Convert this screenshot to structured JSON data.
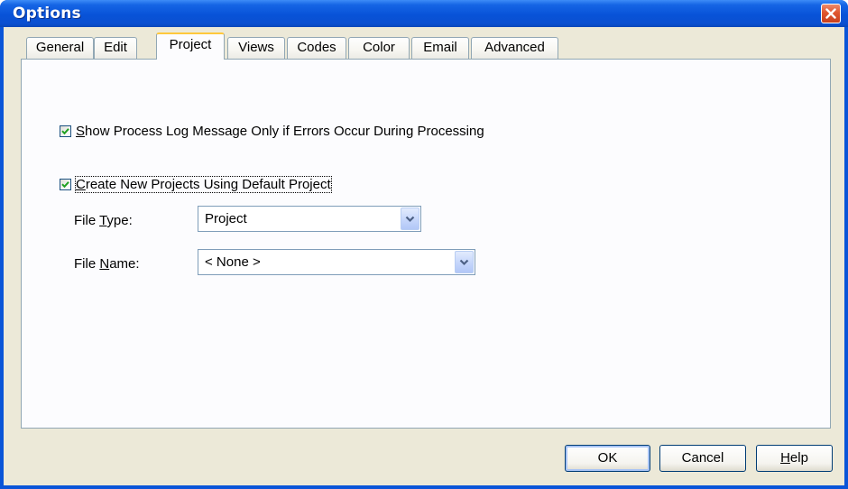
{
  "window": {
    "title": "Options"
  },
  "tabs": [
    {
      "label": "General",
      "active": false
    },
    {
      "label": "Edit",
      "active": false
    },
    {
      "label": "Project",
      "active": true
    },
    {
      "label": "Views",
      "active": false
    },
    {
      "label": "Codes",
      "active": false
    },
    {
      "label": "Color",
      "active": false
    },
    {
      "label": "Email",
      "active": false
    },
    {
      "label": "Advanced",
      "active": false
    }
  ],
  "project": {
    "show_log_checkbox": {
      "checked": true,
      "mnemonic": "S",
      "label_rest": "how Process Log Message Only if Errors Occur During Processing"
    },
    "create_new_checkbox": {
      "checked": true,
      "mnemonic": "C",
      "label_rest": "reate New Projects Using Default Project"
    },
    "file_type": {
      "label_pre": "File ",
      "mnemonic": "T",
      "label_post": "ype:",
      "value": "Project"
    },
    "file_name": {
      "label_pre": "File ",
      "mnemonic": "N",
      "label_post": "ame:",
      "value": "< None >"
    }
  },
  "buttons": {
    "ok": "OK",
    "cancel": "Cancel",
    "help_mnemonic": "H",
    "help_rest": "elp"
  },
  "colors": {
    "titlebar": "#0a55d8",
    "dialog_background": "#ece9d8",
    "panel_background": "#fcfcfe",
    "active_tab_highlight": "#ffc83c",
    "close_button": "#e0562f",
    "checkmark": "#21a121"
  },
  "icons": {
    "close": "close-x-icon",
    "dropdown": "chevron-down-icon",
    "check": "checkmark-icon"
  }
}
